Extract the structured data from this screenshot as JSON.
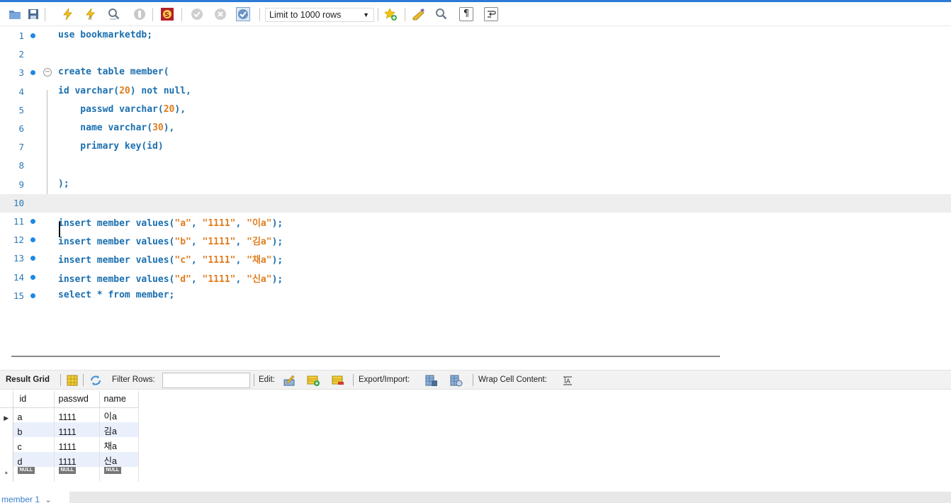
{
  "toolbar": {
    "icons": [
      "open-folder-icon",
      "save-icon",
      "execute-icon",
      "execute-line-icon",
      "explain-icon",
      "stop-icon",
      "toggle-continue-icon",
      "commit-icon",
      "rollback-icon",
      "autocommit-icon",
      "add-snippet-icon",
      "beautify-icon",
      "find-icon",
      "invisible-chars-icon",
      "wrap-icon"
    ],
    "limit_label": "Limit to 1000 rows"
  },
  "editor": {
    "lines": [
      {
        "num": "1",
        "exec": true,
        "segments": [
          [
            "kw",
            "use bookmarketdb;"
          ]
        ]
      },
      {
        "num": "2",
        "exec": false,
        "segments": []
      },
      {
        "num": "3",
        "exec": true,
        "segments": [
          [
            "kw",
            "create table member("
          ]
        ]
      },
      {
        "num": "4",
        "exec": false,
        "segments": [
          [
            "kw",
            "id varchar("
          ],
          [
            "num",
            "20"
          ],
          [
            "kw",
            ") not null,"
          ]
        ]
      },
      {
        "num": "5",
        "exec": false,
        "segments": [
          [
            "kw",
            "    passwd varchar("
          ],
          [
            "num",
            "20"
          ],
          [
            "kw",
            "),"
          ]
        ]
      },
      {
        "num": "6",
        "exec": false,
        "segments": [
          [
            "kw",
            "    name varchar("
          ],
          [
            "num",
            "30"
          ],
          [
            "kw",
            "),"
          ]
        ]
      },
      {
        "num": "7",
        "exec": false,
        "segments": [
          [
            "kw",
            "    primary key(id)"
          ]
        ]
      },
      {
        "num": "8",
        "exec": false,
        "segments": []
      },
      {
        "num": "9",
        "exec": false,
        "segments": [
          [
            "kw",
            ");"
          ]
        ]
      },
      {
        "num": "10",
        "exec": false,
        "segments": []
      },
      {
        "num": "11",
        "exec": true,
        "segments": [
          [
            "kw",
            "insert member values("
          ],
          [
            "str",
            "\"a\""
          ],
          [
            "kw",
            ", "
          ],
          [
            "str",
            "\"1111\""
          ],
          [
            "kw",
            ", "
          ],
          [
            "str",
            "\"이a\""
          ],
          [
            "kw",
            ");"
          ]
        ]
      },
      {
        "num": "12",
        "exec": true,
        "segments": [
          [
            "kw",
            "insert member values("
          ],
          [
            "str",
            "\"b\""
          ],
          [
            "kw",
            ", "
          ],
          [
            "str",
            "\"1111\""
          ],
          [
            "kw",
            ", "
          ],
          [
            "str",
            "\"김a\""
          ],
          [
            "kw",
            ");"
          ]
        ]
      },
      {
        "num": "13",
        "exec": true,
        "segments": [
          [
            "kw",
            "insert member values("
          ],
          [
            "str",
            "\"c\""
          ],
          [
            "kw",
            ", "
          ],
          [
            "str",
            "\"1111\""
          ],
          [
            "kw",
            ", "
          ],
          [
            "str",
            "\"채a\""
          ],
          [
            "kw",
            ");"
          ]
        ]
      },
      {
        "num": "14",
        "exec": true,
        "segments": [
          [
            "kw",
            "insert member values("
          ],
          [
            "str",
            "\"d\""
          ],
          [
            "kw",
            ", "
          ],
          [
            "str",
            "\"1111\""
          ],
          [
            "kw",
            ", "
          ],
          [
            "str",
            "\"신a\""
          ],
          [
            "kw",
            ");"
          ]
        ]
      },
      {
        "num": "15",
        "exec": true,
        "segments": [
          [
            "kw",
            "select * from member;"
          ]
        ]
      }
    ]
  },
  "result_toolbar": {
    "result_grid": "Result Grid",
    "filter_rows": "Filter Rows:",
    "filter_value": "",
    "edit": "Edit:",
    "export_import": "Export/Import:",
    "wrap": "Wrap Cell Content:"
  },
  "grid": {
    "columns": [
      "id",
      "passwd",
      "name"
    ],
    "rows": [
      [
        "a",
        "1111",
        "이a"
      ],
      [
        "b",
        "1111",
        "김a"
      ],
      [
        "c",
        "1111",
        "채a"
      ],
      [
        "d",
        "1111",
        "신a"
      ]
    ],
    "null_label": "NULL"
  },
  "bottom_tabs": [
    {
      "label": "member 1"
    }
  ],
  "colors": {
    "keyword": "#1a6fb0",
    "literal": "#e07c1e",
    "accent": "#2b7bd6"
  }
}
